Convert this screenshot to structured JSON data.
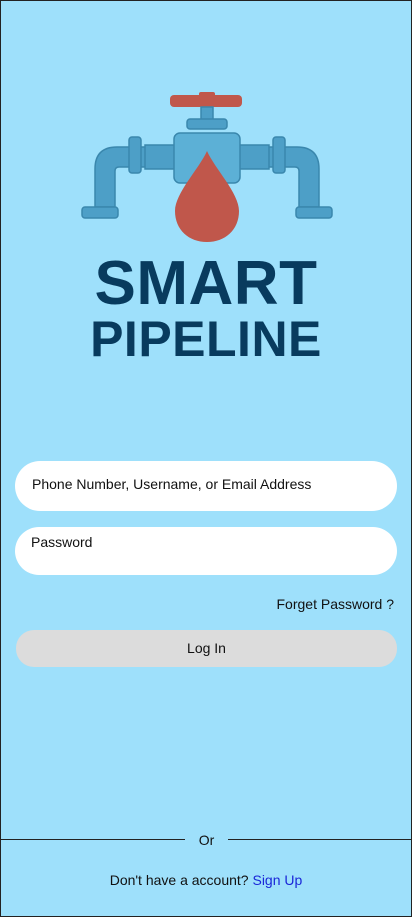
{
  "brand": {
    "line1": "SMART",
    "line2": "PIPELINE",
    "text_color": "#083b5e"
  },
  "logo": {
    "icon": "pipeline-valve-drop-icon",
    "pipe_color": "#4d9fc7",
    "valve_color": "#c0574b",
    "drop_color": "#c0574b"
  },
  "form": {
    "username_placeholder": "Phone Number, Username, or Email Address",
    "password_placeholder": "Password",
    "forgot_label": "Forget Password ?",
    "login_label": "Log In"
  },
  "divider": {
    "label": "Or"
  },
  "signup": {
    "prompt": "Don't have a account?",
    "link_label": "Sign Up",
    "link_color": "#1a26d8"
  },
  "colors": {
    "background": "#9ee0fb",
    "field_background": "#ffffff",
    "button_background": "#dcdcdc"
  }
}
